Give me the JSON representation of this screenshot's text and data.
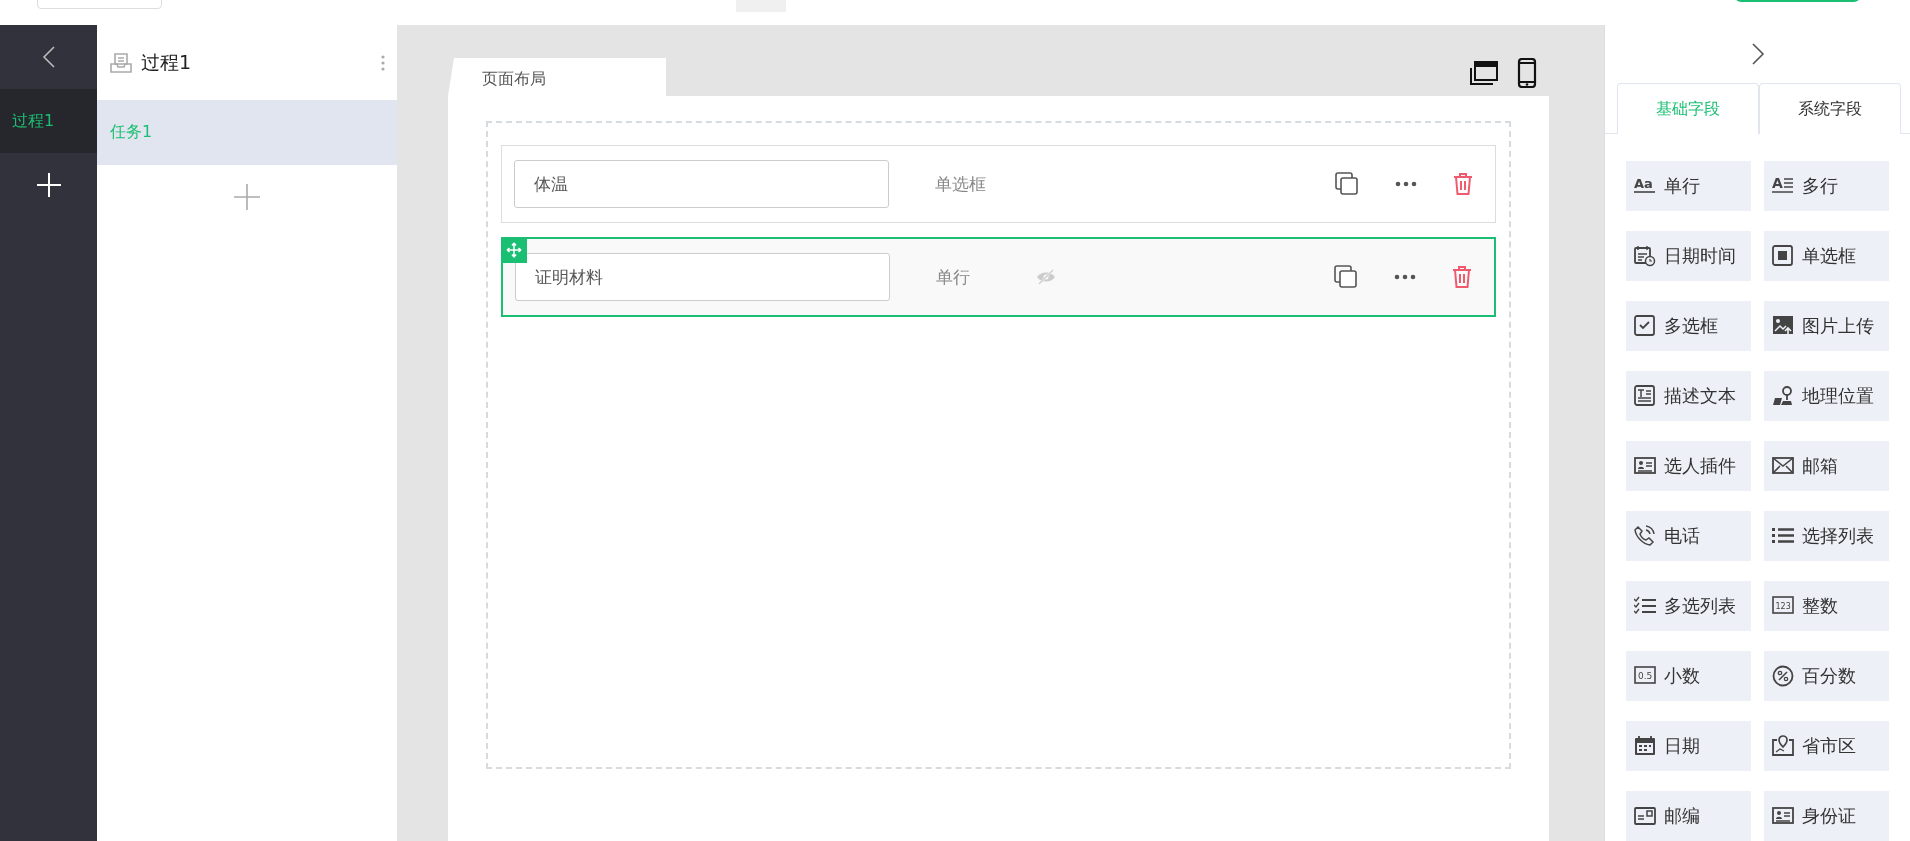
{
  "nav_rail": {
    "items": [
      {
        "label": "过程1",
        "selected": true
      }
    ]
  },
  "process_panel": {
    "title": "过程1",
    "tasks": [
      {
        "label": "任务1",
        "selected": true
      }
    ]
  },
  "canvas": {
    "tab": "页面布局",
    "fields": [
      {
        "value": "体温",
        "type": "单选框",
        "hidden": false,
        "selected": false
      },
      {
        "value": "证明材料",
        "type": "单行",
        "hidden": true,
        "selected": true
      }
    ]
  },
  "palette": {
    "tabs": [
      {
        "label": "基础字段",
        "selected": true
      },
      {
        "label": "系统字段",
        "selected": false
      }
    ],
    "items": [
      {
        "label": "单行",
        "kind": "text",
        "icon_text": "Aa"
      },
      {
        "label": "多行",
        "kind": "multiline",
        "icon_text": "A"
      },
      {
        "label": "日期时间",
        "kind": "datetime"
      },
      {
        "label": "单选框",
        "kind": "radio"
      },
      {
        "label": "多选框",
        "kind": "checkbox"
      },
      {
        "label": "图片上传",
        "kind": "image"
      },
      {
        "label": "描述文本",
        "kind": "description"
      },
      {
        "label": "地理位置",
        "kind": "location"
      },
      {
        "label": "选人插件",
        "kind": "person"
      },
      {
        "label": "邮箱",
        "kind": "email"
      },
      {
        "label": "电话",
        "kind": "phone"
      },
      {
        "label": "选择列表",
        "kind": "list"
      },
      {
        "label": "多选列表",
        "kind": "checklist"
      },
      {
        "label": "整数",
        "kind": "integer",
        "icon_text": "123"
      },
      {
        "label": "小数",
        "kind": "decimal",
        "icon_text": "0.5"
      },
      {
        "label": "百分数",
        "kind": "percent"
      },
      {
        "label": "日期",
        "kind": "date"
      },
      {
        "label": "省市区",
        "kind": "region"
      },
      {
        "label": "邮编",
        "kind": "postcode"
      },
      {
        "label": "身份证",
        "kind": "idcard"
      }
    ]
  }
}
